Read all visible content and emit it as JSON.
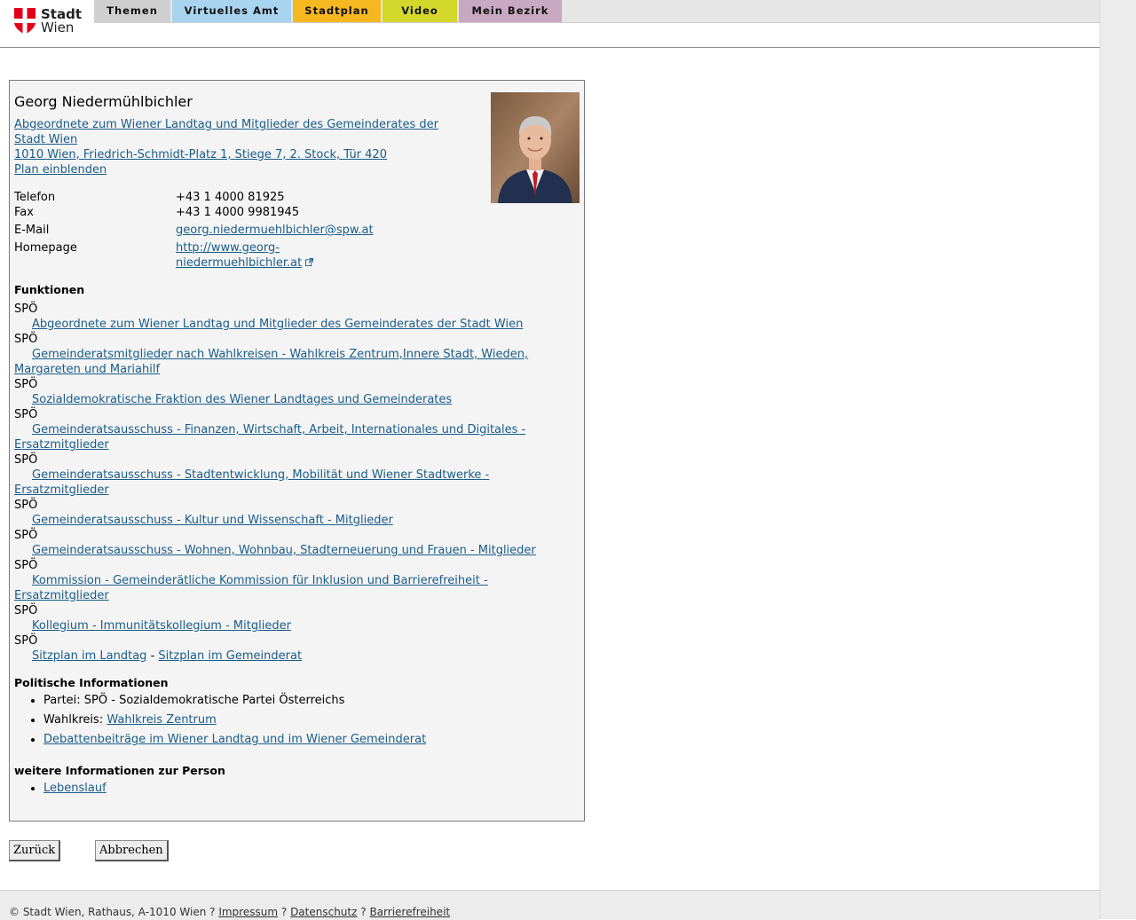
{
  "header": {
    "logo_line1": "Stadt",
    "logo_line2": "Wien",
    "tabs": [
      "Themen",
      "Virtuelles Amt",
      "Stadtplan",
      "Video",
      "Mein Bezirk"
    ],
    "colors": {
      "themen": "#cfcfcf",
      "virtuelles_amt": "#a8d4f0",
      "stadtplan": "#f5b820",
      "video": "#d4d82a",
      "mein_bezirk": "#c9a8c2"
    }
  },
  "person": {
    "name": "Georg Niedermühlbichler",
    "role_line1": "Abgeordnete zum Wiener Landtag und Mitglieder des Gemeinderates der",
    "role_line2": "Stadt Wien",
    "address": "1010 Wien, Friedrich-Schmidt-Platz 1, Stiege 7, 2. Stock, Tür 420",
    "plan_link": "Plan einblenden",
    "photo_icon": "portrait-photo"
  },
  "contact": {
    "phone_label": "Telefon",
    "phone": "+43 1 4000 81925",
    "fax_label": "Fax",
    "fax": "+43 1 4000 9981945",
    "email_label": "E-Mail",
    "email": "georg.niedermuehlbichler@spw.at",
    "homepage_label": "Homepage",
    "homepage_line1": "http://www.georg-",
    "homepage_line2": "niedermuehlbichler.at",
    "homepage_icon": "external-link-icon"
  },
  "funktionen": {
    "heading": "Funktionen",
    "party": "SPÖ",
    "items": [
      {
        "line1": "Abgeordnete zum Wiener Landtag und Mitglieder des Gemeinderates der Stadt Wien"
      },
      {
        "line1": "Gemeinderatsmitglieder nach Wahlkreisen - Wahlkreis Zentrum,Innere Stadt, Wieden,",
        "line2": "Margareten und Mariahilf"
      },
      {
        "line1": "Sozialdemokratische Fraktion des Wiener Landtages und Gemeinderates"
      },
      {
        "line1": "Gemeinderatsausschuss - Finanzen, Wirtschaft, Arbeit, Internationales und Digitales -",
        "line2": "Ersatzmitglieder"
      },
      {
        "line1": "Gemeinderatsausschuss - Stadtentwicklung, Mobilität und Wiener Stadtwerke -",
        "line2": "Ersatzmitglieder"
      },
      {
        "line1": "Gemeinderatsausschuss - Kultur und Wissenschaft - Mitglieder"
      },
      {
        "line1": "Gemeinderatsausschuss - Wohnen, Wohnbau, Stadterneuerung und Frauen - Mitglieder"
      },
      {
        "line1": "Kommission - Gemeinderätliche Kommission für Inklusion und Barrierefreiheit -",
        "line2": "Ersatzmitglieder"
      },
      {
        "line1": "Kollegium - Immunitätskollegium - Mitglieder"
      }
    ],
    "sitzplan_landtag": "Sitzplan im Landtag",
    "separator": "-",
    "sitzplan_gemeinderat": "Sitzplan im Gemeinderat"
  },
  "politisch": {
    "heading": "Politische Informationen",
    "partei": "Partei: SPÖ - Sozialdemokratische Partei Österreichs",
    "wahlkreis_label": "Wahlkreis:",
    "wahlkreis_link": "Wahlkreis Zentrum",
    "debatten_link": "Debattenbeiträge im Wiener Landtag und im Wiener Gemeinderat"
  },
  "weitere": {
    "heading": "weitere Informationen zur Person",
    "lebenslauf": "Lebenslauf"
  },
  "buttons": {
    "back": "Zurück",
    "cancel": "Abbrechen"
  },
  "footer": {
    "copyright": "© Stadt Wien, Rathaus, A-1010 Wien ?",
    "impressum": "Impressum",
    "sep": "?",
    "datenschutz": "Datenschutz",
    "barrierefreiheit": "Barrierefreiheit"
  }
}
